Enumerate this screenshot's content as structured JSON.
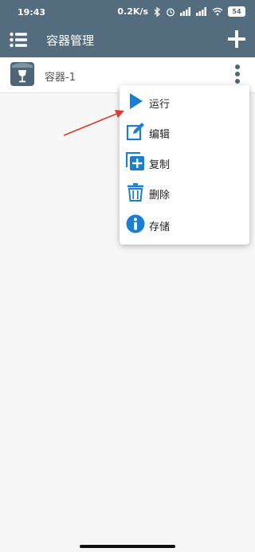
{
  "status_bar": {
    "time": "19:43",
    "speed": "0.2K/s",
    "battery": "54"
  },
  "app_bar": {
    "title": "容器管理"
  },
  "containers": [
    {
      "name": "容器-1"
    }
  ],
  "popup_menu": {
    "items": [
      {
        "label": "运行",
        "icon": "play-icon"
      },
      {
        "label": "编辑",
        "icon": "edit-icon"
      },
      {
        "label": "复制",
        "icon": "copy-icon"
      },
      {
        "label": "删除",
        "icon": "trash-icon"
      },
      {
        "label": "存储",
        "icon": "info-icon"
      }
    ]
  },
  "colors": {
    "app_bar": "#546d7e",
    "accent": "#1a7fd0",
    "annotation_arrow": "#e0392b"
  }
}
